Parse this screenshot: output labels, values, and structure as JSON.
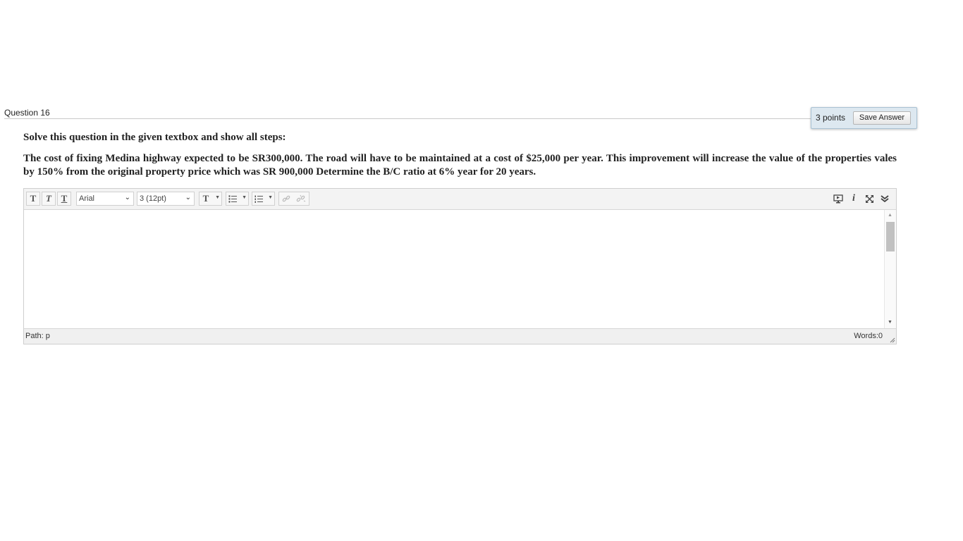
{
  "question": {
    "title": "Question 16",
    "points": "3 points",
    "save_label": "Save Answer",
    "instruction": "Solve this question in the given textbox and show all steps:",
    "text": "The cost of fixing Medina highway expected to be SR300,000. The road will have to be maintained at a cost of $25,000 per year. This improvement will increase the value of the properties vales by 150% from the original property price which was SR 900,000 Determine the B/C ratio at 6% year for 20 years."
  },
  "editor": {
    "font_family": "Arial",
    "font_size": "3 (12pt)",
    "content": "",
    "path": "Path: p",
    "words": "Words:0"
  }
}
